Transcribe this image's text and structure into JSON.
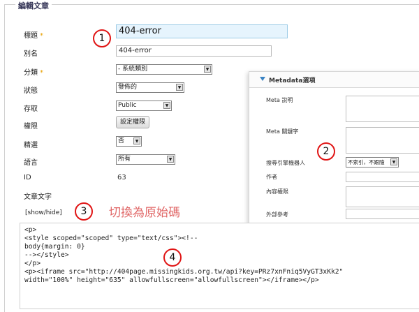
{
  "fieldset": {
    "legend": "編輯文章"
  },
  "form": {
    "title": {
      "label": "標題",
      "required_mark": "*",
      "value": "404-error"
    },
    "alias": {
      "label": "別名",
      "value": "404-error"
    },
    "category": {
      "label": "分類",
      "required_mark": "*",
      "selected": "- 系統類別"
    },
    "status": {
      "label": "狀態",
      "selected": "發佈的"
    },
    "access": {
      "label": "存取",
      "selected": "Public"
    },
    "permissions": {
      "label": "權限",
      "button": "設定權限"
    },
    "featured": {
      "label": "精選",
      "selected": "否"
    },
    "language": {
      "label": "語言",
      "selected": "所有"
    },
    "id": {
      "label": "ID",
      "value": "63"
    },
    "article_text": {
      "label": "文章文字"
    }
  },
  "metadata_panel": {
    "title": "Metadata選項",
    "meta_description": {
      "label": "Meta 說明"
    },
    "meta_keywords": {
      "label": "Meta 關鍵字"
    },
    "robots": {
      "label": "搜尋引擎機器人",
      "selected": "不索引，不跟隨"
    },
    "author": {
      "label": "作者"
    },
    "content_rights": {
      "label": "內容權限"
    },
    "external_reference": {
      "label": "外部參考"
    }
  },
  "editor_toggle": {
    "label": "[show/hide]"
  },
  "annotation_text": "切換為原始碼",
  "callouts": {
    "one": "1",
    "two": "2",
    "three": "3",
    "four": "4"
  },
  "editor": {
    "lines": [
      "<p>",
      "<style scoped=\"scoped\" type=\"text/css\"><!--",
      "body{margin: 0}",
      "--></style>",
      "</p>",
      "<p><iframe src=\"http://404page.missingkids.org.tw/api?key=PRz7xnFniq5VyGT3xKk2\"",
      "width=\"100%\" height=\"635\" allowfullscreen=\"allowfullscreen\"></iframe></p>"
    ]
  },
  "colors": {
    "callout_border": "#e01515",
    "annotation": "#e06666",
    "title_field_bg": "#e6f4fd",
    "panel_arrow": "#3b84c4"
  },
  "icons": {
    "dropdown": "chevron-down-icon",
    "panel_toggle": "triangle-down-icon"
  }
}
